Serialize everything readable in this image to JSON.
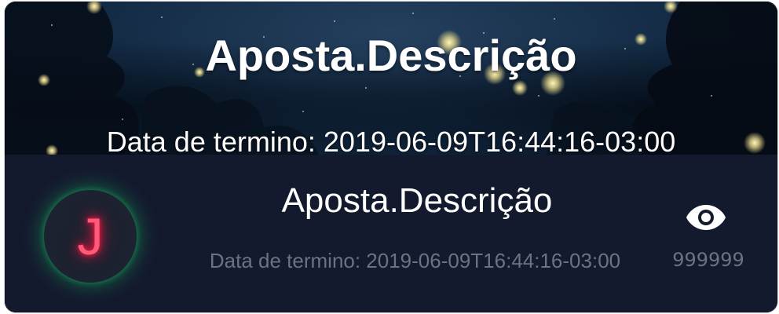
{
  "banner": {
    "title": "Aposta.Descrição",
    "date_text": "Data de termino: 2019-06-09T16:44:16-03:00"
  },
  "item": {
    "avatar_letter": "J",
    "title": "Aposta.Descrição",
    "date_text": "Data de termino: 2019-06-09T16:44:16-03:00",
    "views_icon": "eye-icon",
    "views_count": "999999"
  },
  "colors": {
    "card_background": "#141a2e",
    "avatar_glow": "#14a05a",
    "avatar_letter": "#ff1744",
    "muted_text": "#6b7280",
    "title_text": "#ffffff"
  }
}
